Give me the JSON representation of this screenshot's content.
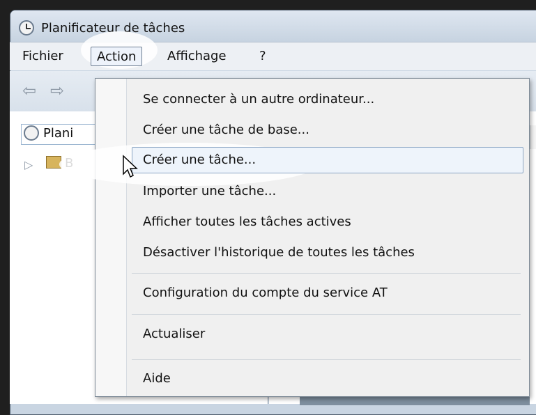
{
  "window": {
    "title": "Planificateur de tâches"
  },
  "menubar": {
    "items": [
      "Fichier",
      "Action",
      "Affichage",
      "?"
    ]
  },
  "tree": {
    "root_label": "Plani",
    "child_label": "B"
  },
  "dropdown": {
    "items": [
      "Se connecter à un autre ordinateur...",
      "Créer une tâche de base...",
      "Créer une tâche...",
      "Importer une tâche...",
      "Afficher toutes les tâches actives",
      "Désactiver l'historique de toutes les tâches",
      "Configuration du compte du service AT",
      "Actualiser",
      "Aide"
    ]
  },
  "colors": {
    "window_bg": "#c9d5e2",
    "menu_bg": "#edf0f4",
    "dropdown_bg": "#f0f0f0",
    "hover_bg": "#eef4fb",
    "hover_border": "#8aa5c3"
  }
}
